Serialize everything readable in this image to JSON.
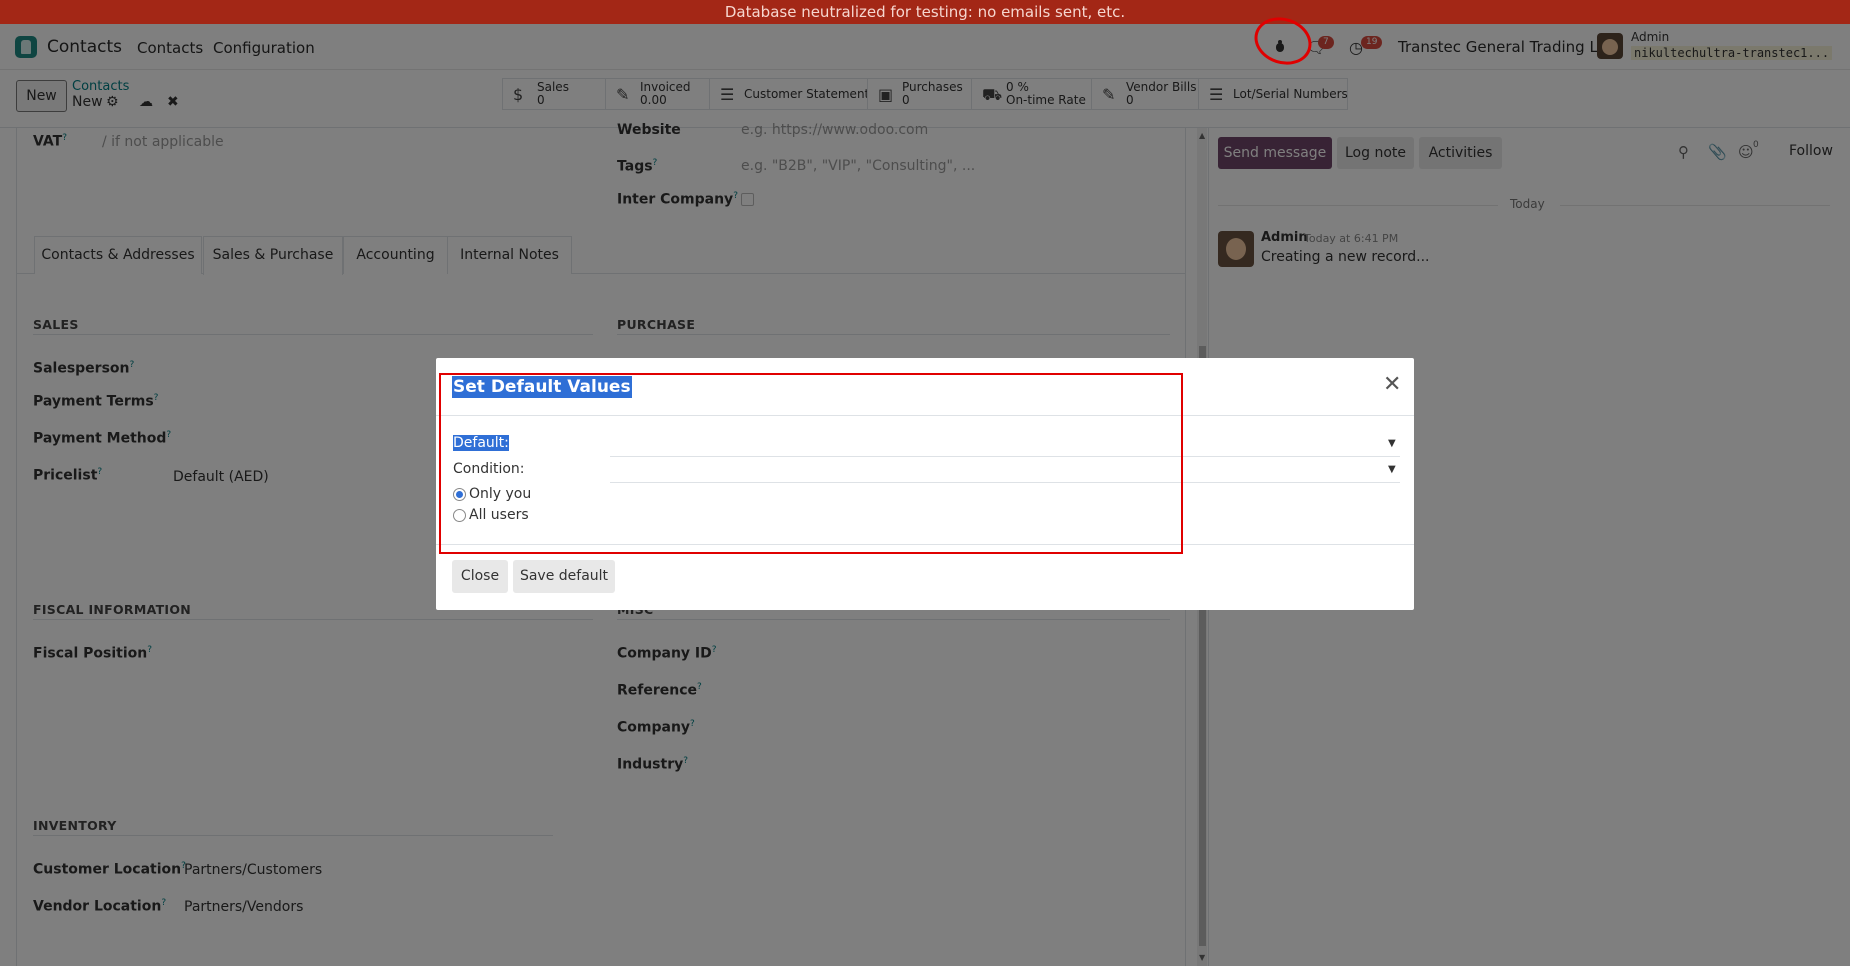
{
  "banner": {
    "text": "Database neutralized for testing: no emails sent, etc."
  },
  "navbar": {
    "app_name": "Contacts",
    "menu": [
      "Contacts",
      "Configuration"
    ],
    "messages_badge": "7",
    "activities_badge": "19",
    "company": "Transtec General Trading LLC",
    "user": "Admin",
    "database": "nikultechultra-transtec1..."
  },
  "controlbar": {
    "new_label": "New",
    "breadcrumb_parent": "Contacts",
    "breadcrumb_current": "New",
    "stat_buttons": [
      {
        "label": "Sales",
        "value": "0",
        "icon": "dollar-icon"
      },
      {
        "label": "Invoiced",
        "value": "0.00",
        "icon": "edit-icon"
      },
      {
        "label": "Customer Statement",
        "icon": "list-icon"
      },
      {
        "label": "Purchases",
        "value": "0",
        "icon": "credit-card-icon"
      },
      {
        "label": "0 %",
        "value": "On-time Rate",
        "icon": "truck-icon"
      },
      {
        "label": "Vendor Bills",
        "value": "0",
        "icon": "edit-icon"
      },
      {
        "label": "Lot/Serial Numbers",
        "icon": "bars-icon"
      }
    ]
  },
  "form": {
    "vat_label": "VAT",
    "vat_placeholder": "/ if not applicable",
    "website_label": "Website",
    "website_placeholder": "e.g. https://www.odoo.com",
    "tags_label": "Tags",
    "tags_placeholder": "e.g. \"B2B\", \"VIP\", \"Consulting\", ...",
    "inter_company_label": "Inter Company",
    "tabs": [
      "Contacts & Addresses",
      "Sales & Purchase",
      "Accounting",
      "Internal Notes"
    ],
    "sales_title": "SALES",
    "purchase_title": "PURCHASE",
    "salesperson_label": "Salesperson",
    "payment_terms_label": "Payment Terms",
    "payment_method_label": "Payment Method",
    "pricelist_label": "Pricelist",
    "pricelist_value": "Default (AED)",
    "fiscal_title": "FISCAL INFORMATION",
    "misc_title": "MISC",
    "fiscal_position_label": "Fiscal Position",
    "company_id_label": "Company ID",
    "reference_label": "Reference",
    "company_label": "Company",
    "industry_label": "Industry",
    "inventory_title": "INVENTORY",
    "customer_location_label": "Customer Location",
    "customer_location_value": "Partners/Customers",
    "vendor_location_label": "Vendor Location",
    "vendor_location_value": "Partners/Vendors"
  },
  "chatter": {
    "send_message": "Send message",
    "log_note": "Log note",
    "activities": "Activities",
    "followers_count": "0",
    "follow": "Follow",
    "today": "Today",
    "message": {
      "author": "Admin",
      "time": "Today at 6:41 PM",
      "body": "Creating a new record..."
    }
  },
  "modal": {
    "title": "Set Default Values",
    "default_label": "Default:",
    "condition_label": "Condition:",
    "radio_only_you": "Only you",
    "radio_all_users": "All users",
    "selected_radio": "Only you",
    "close_button": "Close",
    "save_button": "Save default"
  },
  "colors": {
    "banner": "#a32716",
    "accent": "#017e84",
    "primary_button": "#71476a",
    "selection": "#2f6fd6",
    "annotation": "#e00000"
  }
}
